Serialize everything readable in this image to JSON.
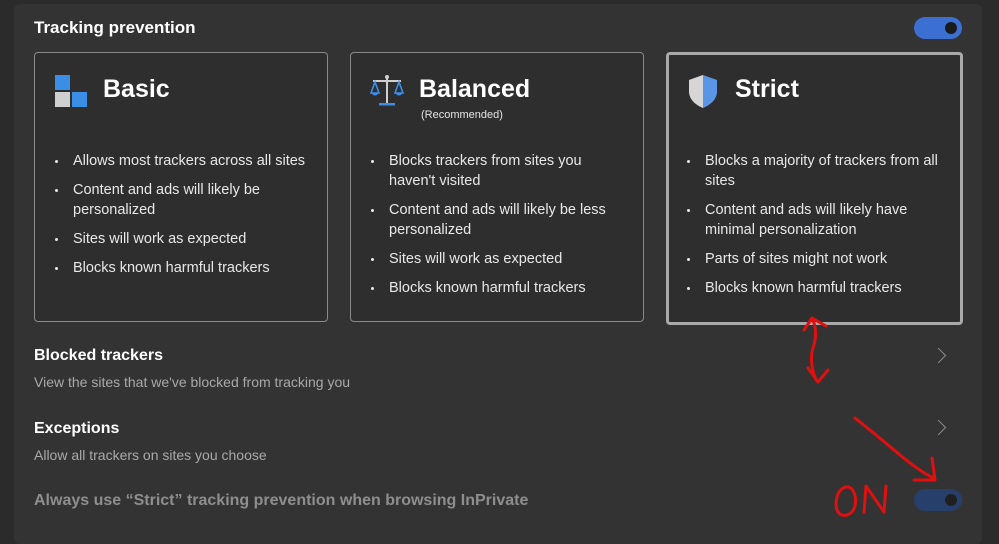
{
  "section": {
    "title": "Tracking prevention",
    "toggle_state": "on"
  },
  "cards": [
    {
      "name": "Basic",
      "subtitle": "",
      "icon": "basic-blocks-icon",
      "bullets": [
        "Allows most trackers across all sites",
        "Content and ads will likely be personalized",
        "Sites will work as expected",
        "Blocks known harmful trackers"
      ],
      "selected": false
    },
    {
      "name": "Balanced",
      "subtitle": "(Recommended)",
      "icon": "scales-icon",
      "bullets": [
        "Blocks trackers from sites you haven't visited",
        "Content and ads will likely be less personalized",
        "Sites will work as expected",
        "Blocks known harmful trackers"
      ],
      "selected": false
    },
    {
      "name": "Strict",
      "subtitle": "",
      "icon": "shield-icon",
      "bullets": [
        "Blocks a majority of trackers from all sites",
        "Content and ads will likely have minimal personalization",
        "Parts of sites might not work",
        "Blocks known harmful trackers"
      ],
      "selected": true
    }
  ],
  "blocked_trackers": {
    "title": "Blocked trackers",
    "description": "View the sites that we've blocked from tracking you"
  },
  "exceptions": {
    "title": "Exceptions",
    "description": "Allow all trackers on sites you choose"
  },
  "inprivate": {
    "label": "Always use “Strict” tracking prevention when browsing InPrivate",
    "toggle_state": "on",
    "disabled": true
  },
  "annotation": {
    "text": "ON",
    "color": "#e01010"
  },
  "colors": {
    "accent": "#3b6fd1",
    "panel": "#333333",
    "background": "#2b2b2b"
  }
}
